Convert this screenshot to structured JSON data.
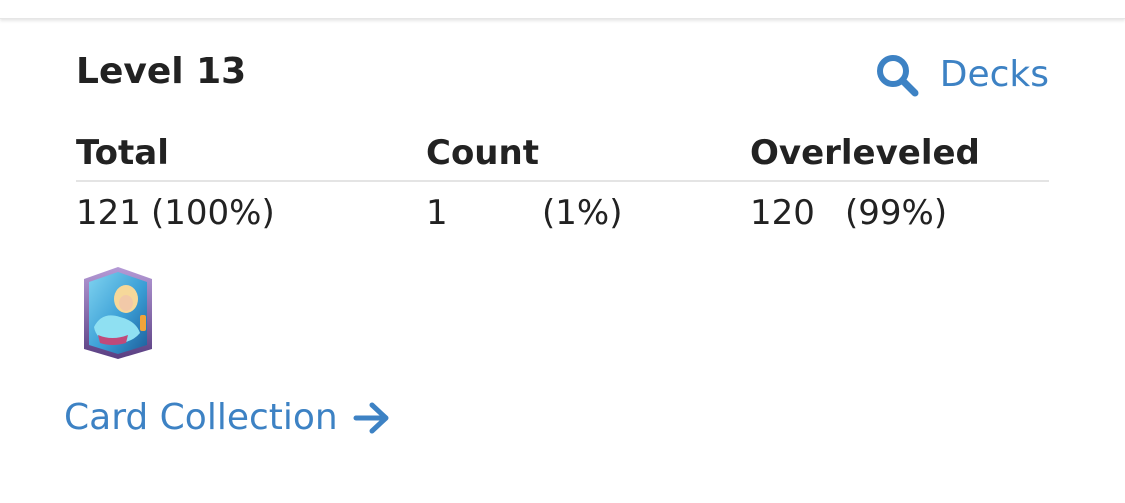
{
  "header": {
    "level_title": "Level 13",
    "decks_label": "Decks",
    "decks_icon": "search-icon"
  },
  "stats": {
    "columns": [
      "Total",
      "Count",
      "Overleveled"
    ],
    "row": {
      "total_value": "121",
      "total_pct": "(100%)",
      "count_value": "1",
      "count_pct": "(1%)",
      "overleveled_value": "120",
      "overleveled_pct": "(99%)"
    }
  },
  "cards": [
    {
      "icon": "card-thumbnail-icon"
    }
  ],
  "footer": {
    "collection_label": "Card Collection",
    "collection_icon": "arrow-right-icon"
  },
  "colors": {
    "link": "#3d82c4",
    "text": "#222222",
    "muted": "#555555",
    "divider": "#e4e4e4"
  }
}
